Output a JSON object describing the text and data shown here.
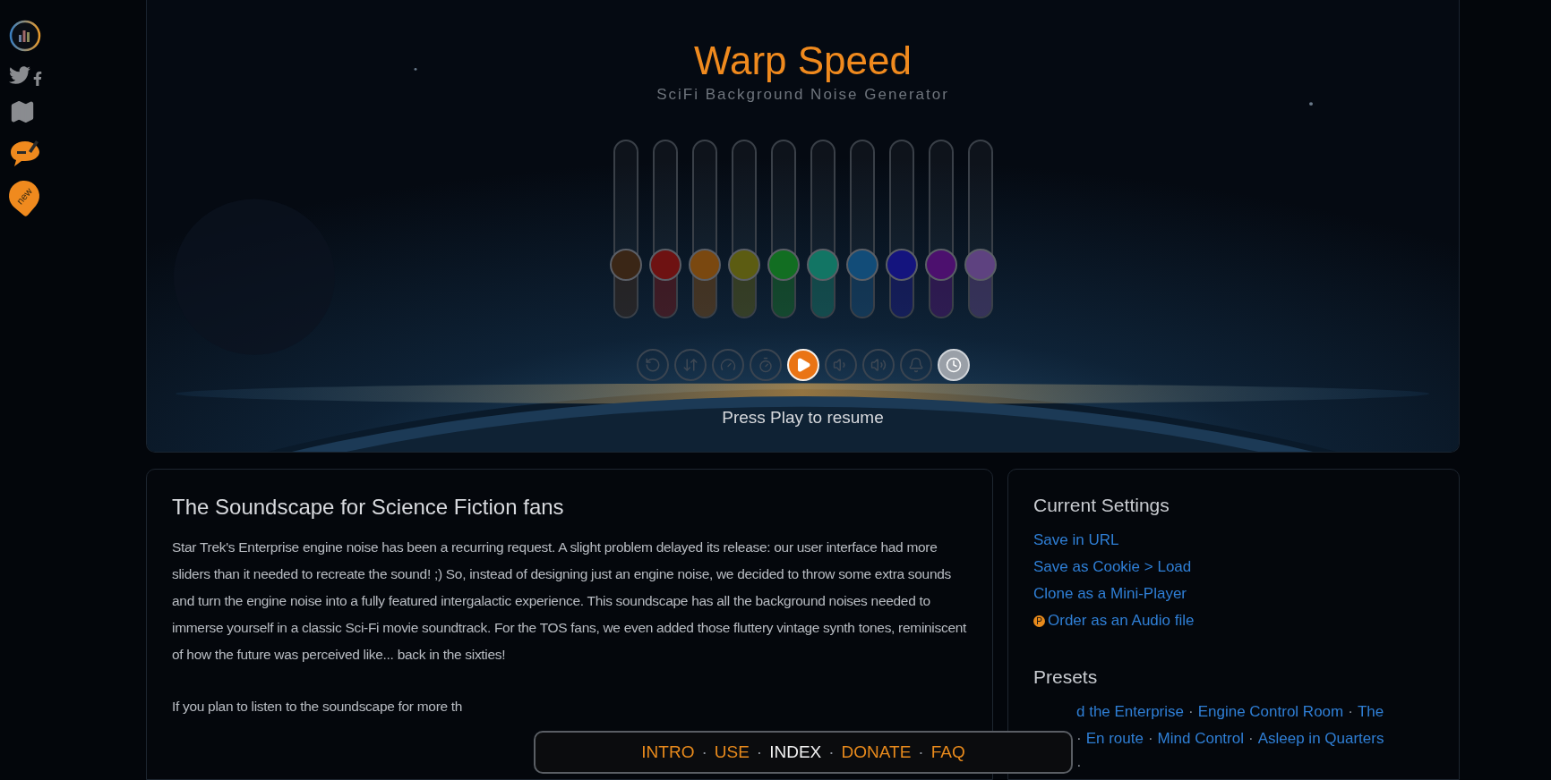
{
  "sidebar": {
    "badge_label": "new"
  },
  "header": {
    "title": "Warp Speed",
    "subtitle": "SciFi Background Noise Generator"
  },
  "sliders": [
    {
      "color": "#3a2616",
      "level": 0.3
    },
    {
      "color": "#6e1212",
      "level": 0.3
    },
    {
      "color": "#7a4810",
      "level": 0.3
    },
    {
      "color": "#5c5c12",
      "level": 0.3
    },
    {
      "color": "#126e22",
      "level": 0.3
    },
    {
      "color": "#127564",
      "level": 0.3
    },
    {
      "color": "#124c78",
      "level": 0.3
    },
    {
      "color": "#14147e",
      "level": 0.3
    },
    {
      "color": "#4c106e",
      "level": 0.3
    },
    {
      "color": "#5e4280",
      "level": 0.3
    }
  ],
  "controls": [
    {
      "kind": "reset",
      "on": false
    },
    {
      "kind": "order",
      "on": false
    },
    {
      "kind": "animate",
      "on": false
    },
    {
      "kind": "timer",
      "on": false
    },
    {
      "kind": "play",
      "on": true
    },
    {
      "kind": "volume-down",
      "on": false
    },
    {
      "kind": "volume-up",
      "on": false
    },
    {
      "kind": "alarm",
      "on": false
    },
    {
      "kind": "clock",
      "on": true
    }
  ],
  "status": "Press Play to resume",
  "article": {
    "title": "The Soundscape for Science Fiction fans",
    "paragraphs": [
      "Star Trek's Enterprise engine noise has been a recurring request. A slight problem delayed its release: our user interface had more sliders than it needed to recreate the sound! ;) So, instead of designing just an engine noise, we decided to throw some extra sounds and turn the engine noise into a fully featured intergalactic experience. This soundscape has all the background noises needed to immerse yourself in a classic Sci-Fi movie soundtrack. For the TOS fans, we even added those fluttery vintage synth tones, reminiscent of how the future was perceived like... back in the sixties!",
      "If you plan to listen to the soundscape for more th"
    ]
  },
  "settings": {
    "title": "Current Settings",
    "links": [
      {
        "label": "Save in URL"
      },
      {
        "label": "Save as Cookie > Load"
      },
      {
        "label": "Clone as a Mini-Player"
      },
      {
        "label": "Order as an Audio file",
        "badge": "P"
      }
    ]
  },
  "presets": {
    "title": "Presets",
    "items": [
      {
        "kind": "link",
        "text": "d the Enterprise"
      },
      {
        "kind": "sep",
        "text": "·"
      },
      {
        "kind": "link",
        "text": "Engine Control Room"
      },
      {
        "kind": "sep",
        "text": "·"
      },
      {
        "kind": "link",
        "text": "The"
      },
      {
        "kind": "sep",
        "text": "·"
      },
      {
        "kind": "link",
        "text": "En route"
      },
      {
        "kind": "sep",
        "text": "·"
      },
      {
        "kind": "link",
        "text": "Mind Control"
      },
      {
        "kind": "sep",
        "text": "·"
      },
      {
        "kind": "link",
        "text": "Asleep in Quarters"
      },
      {
        "kind": "sep",
        "text": "·"
      }
    ]
  },
  "nav": [
    {
      "kind": "link",
      "text": "INTRO",
      "selected": false
    },
    {
      "kind": "sep",
      "text": "·"
    },
    {
      "kind": "link",
      "text": "USE",
      "selected": false
    },
    {
      "kind": "sep",
      "text": "·"
    },
    {
      "kind": "link",
      "text": "INDEX",
      "selected": true
    },
    {
      "kind": "sep",
      "text": "·"
    },
    {
      "kind": "link",
      "text": "DONATE",
      "selected": false
    },
    {
      "kind": "sep",
      "text": "·"
    },
    {
      "kind": "link",
      "text": "FAQ",
      "selected": false
    }
  ]
}
